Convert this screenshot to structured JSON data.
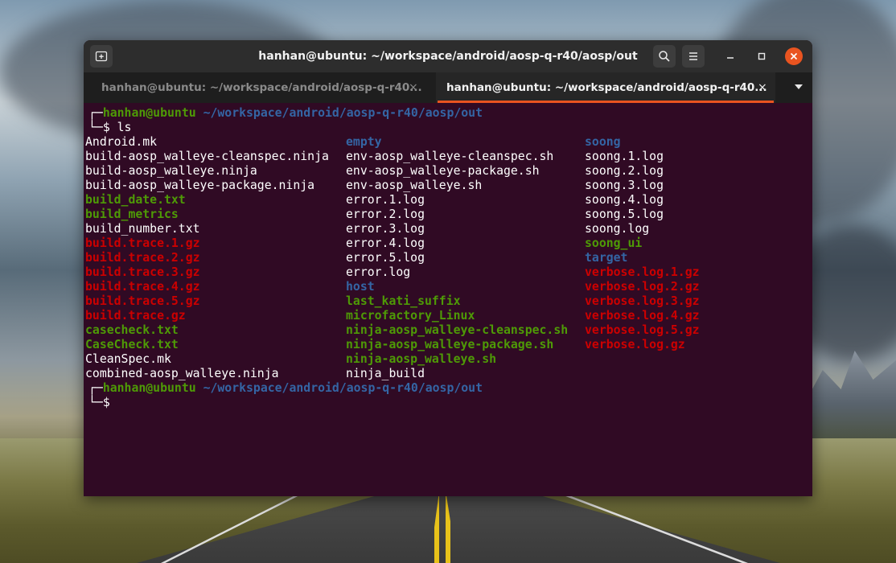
{
  "window": {
    "title": "hanhan@ubuntu: ~/workspace/android/aosp-q-r40/aosp/out",
    "new_tab_icon": "new-tab-icon",
    "search_icon": "search-icon",
    "menu_icon": "hamburger-menu-icon",
    "minimize_icon": "minimize-icon",
    "maximize_icon": "maximize-icon",
    "close_icon": "close-icon"
  },
  "tabs": [
    {
      "label": "hanhan@ubuntu: ~/workspace/android/aosp-q-r40...",
      "active": false,
      "close": "×"
    },
    {
      "label": "hanhan@ubuntu: ~/workspace/android/aosp-q-r40...",
      "active": true,
      "close": "×"
    }
  ],
  "tab_menu_icon": "chevron-down-icon",
  "terminal": {
    "prompt_box_top": "┌─",
    "prompt_box_bottom": "└─",
    "user": "hanhan@ubuntu",
    "path": "~/workspace/android/aosp-q-r40/aosp/out",
    "command": "$ ls",
    "dollar": "$",
    "columns": [
      [
        {
          "text": "Android.mk",
          "type": "file"
        },
        {
          "text": "build-aosp_walleye-cleanspec.ninja",
          "type": "file"
        },
        {
          "text": "build-aosp_walleye.ninja",
          "type": "file"
        },
        {
          "text": "build-aosp_walleye-package.ninja",
          "type": "file"
        },
        {
          "text": "build_date.txt",
          "type": "exec"
        },
        {
          "text": "build_metrics",
          "type": "exec"
        },
        {
          "text": "build_number.txt",
          "type": "file"
        },
        {
          "text": "build.trace.1.gz",
          "type": "arch"
        },
        {
          "text": "build.trace.2.gz",
          "type": "arch"
        },
        {
          "text": "build.trace.3.gz",
          "type": "arch"
        },
        {
          "text": "build.trace.4.gz",
          "type": "arch"
        },
        {
          "text": "build.trace.5.gz",
          "type": "arch"
        },
        {
          "text": "build.trace.gz",
          "type": "arch"
        },
        {
          "text": "casecheck.txt",
          "type": "exec"
        },
        {
          "text": "CaseCheck.txt",
          "type": "exec"
        },
        {
          "text": "CleanSpec.mk",
          "type": "file"
        },
        {
          "text": "combined-aosp_walleye.ninja",
          "type": "file"
        }
      ],
      [
        {
          "text": "empty",
          "type": "dir"
        },
        {
          "text": "env-aosp_walleye-cleanspec.sh",
          "type": "file"
        },
        {
          "text": "env-aosp_walleye-package.sh",
          "type": "file"
        },
        {
          "text": "env-aosp_walleye.sh",
          "type": "file"
        },
        {
          "text": "error.1.log",
          "type": "file"
        },
        {
          "text": "error.2.log",
          "type": "file"
        },
        {
          "text": "error.3.log",
          "type": "file"
        },
        {
          "text": "error.4.log",
          "type": "file"
        },
        {
          "text": "error.5.log",
          "type": "file"
        },
        {
          "text": "error.log",
          "type": "file"
        },
        {
          "text": "host",
          "type": "dir"
        },
        {
          "text": "last_kati_suffix",
          "type": "exec"
        },
        {
          "text": "microfactory_Linux",
          "type": "exec"
        },
        {
          "text": "ninja-aosp_walleye-cleanspec.sh",
          "type": "exec"
        },
        {
          "text": "ninja-aosp_walleye-package.sh",
          "type": "exec"
        },
        {
          "text": "ninja-aosp_walleye.sh",
          "type": "exec"
        },
        {
          "text": "ninja_build",
          "type": "file"
        }
      ],
      [
        {
          "text": "soong",
          "type": "dir"
        },
        {
          "text": "soong.1.log",
          "type": "file"
        },
        {
          "text": "soong.2.log",
          "type": "file"
        },
        {
          "text": "soong.3.log",
          "type": "file"
        },
        {
          "text": "soong.4.log",
          "type": "file"
        },
        {
          "text": "soong.5.log",
          "type": "file"
        },
        {
          "text": "soong.log",
          "type": "file"
        },
        {
          "text": "soong_ui",
          "type": "exec"
        },
        {
          "text": "target",
          "type": "dir"
        },
        {
          "text": "verbose.log.1.gz",
          "type": "arch"
        },
        {
          "text": "verbose.log.2.gz",
          "type": "arch"
        },
        {
          "text": "verbose.log.3.gz",
          "type": "arch"
        },
        {
          "text": "verbose.log.4.gz",
          "type": "arch"
        },
        {
          "text": "verbose.log.5.gz",
          "type": "arch"
        },
        {
          "text": "verbose.log.gz",
          "type": "arch"
        }
      ]
    ]
  },
  "colors": {
    "terminal_bg": "#300a24",
    "user": "#4e9a06",
    "path": "#3465a4",
    "archive": "#cc0000",
    "accent": "#e95420"
  }
}
